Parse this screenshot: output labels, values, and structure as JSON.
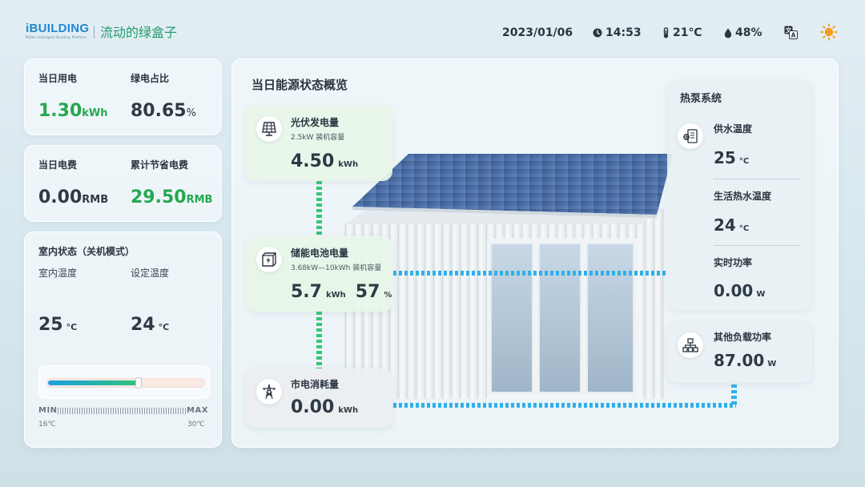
{
  "header": {
    "logo_main": "iBUILDING",
    "logo_sub": "Mideo Intelligent Building Platform",
    "slogan": "流动的绿盒子",
    "date": "2023/01/06",
    "time": "14:53",
    "temperature": "21℃",
    "humidity": "48%",
    "icons": {
      "clock": "clock-icon",
      "thermometer": "thermometer-icon",
      "humidity": "droplet-icon",
      "language": "translate-icon",
      "weather": "sun-icon"
    }
  },
  "energy_card": {
    "daily_use_label": "当日用电",
    "daily_use_value": "1.30",
    "daily_use_unit": "kWh",
    "green_ratio_label": "绿电占比",
    "green_ratio_value": "80.65",
    "green_ratio_unit": "%"
  },
  "cost_card": {
    "daily_cost_label": "当日电费",
    "daily_cost_value": "0.00",
    "daily_cost_unit": "RMB",
    "savings_label": "累计节省电费",
    "savings_value": "29.50",
    "savings_unit": "RMB"
  },
  "indoor_card": {
    "title": "室内状态（关机模式）",
    "indoor_temp_label": "室内温度",
    "set_temp_label": "设定温度",
    "indoor_temp_value": "25",
    "set_temp_value": "24",
    "temp_unit": "°C",
    "slider": {
      "min_label": "MIN",
      "max_label": "MAX",
      "min_value": "16℃",
      "max_value": "30℃",
      "fill_fraction": 0.58
    }
  },
  "overview": {
    "title": "当日能源状态概览",
    "pv": {
      "title": "光伏发电量",
      "capacity": "2.5kW 装机容量",
      "value": "4.50",
      "unit": "kWh",
      "icon": "solar-panel-icon"
    },
    "battery": {
      "title": "储能电池电量",
      "capacity": "3.68kW—10kWh 装机容量",
      "value": "5.7",
      "unit": "kWh",
      "percent": "57",
      "percent_unit": "%",
      "icon": "battery-box-icon"
    },
    "grid": {
      "title": "市电消耗量",
      "value": "0.00",
      "unit": "kWh",
      "icon": "power-tower-icon"
    },
    "heat_pump": {
      "title": "热泵系统",
      "supply_temp_label": "供水温度",
      "supply_temp_value": "25",
      "supply_temp_unit": "°C",
      "hot_water_label": "生活热水温度",
      "hot_water_value": "24",
      "hot_water_unit": "°C",
      "power_label": "实时功率",
      "power_value": "0.00",
      "power_unit": "W",
      "icon": "heat-pump-icon"
    },
    "other_load": {
      "title": "其他负载功率",
      "value": "87.00",
      "unit": "W",
      "icon": "network-load-icon"
    }
  },
  "colors": {
    "brand_blue": "#1f87d6",
    "slogan_green": "#1d9c6b",
    "value_green": "#25a84f",
    "flow_green": "#35c776",
    "flow_blue": "#2fb0ea",
    "sun_orange": "#f59a1b"
  }
}
